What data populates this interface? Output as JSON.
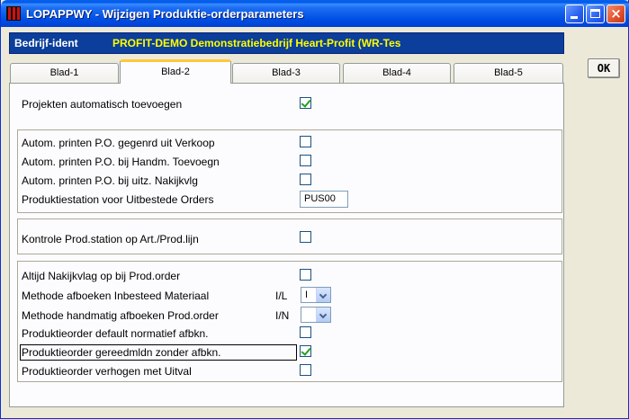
{
  "window": {
    "title": "LOPAPPWY - Wijzigen Produktie-orderparameters",
    "controls": {
      "minimize": "minimize-icon",
      "maximize": "maximize-icon",
      "close": "×"
    }
  },
  "company": {
    "label": "Bedrijf-ident",
    "name": "PROFIT-DEMO Demonstratiebedrijf Heart-Profit (WR-Tes",
    "label_color": "#ffffff",
    "name_color": "#ffff00",
    "bar_color": "#0c3e9b"
  },
  "ok_label": "OK",
  "tabs": [
    {
      "label": "Blad-1",
      "active": false
    },
    {
      "label": "Blad-2",
      "active": true
    },
    {
      "label": "Blad-3",
      "active": false
    },
    {
      "label": "Blad-4",
      "active": false
    },
    {
      "label": "Blad-5",
      "active": false
    }
  ],
  "settings": {
    "projects_auto_add": {
      "label": "Projekten automatisch toevoegen",
      "checked": true
    },
    "print_from_sales": {
      "label": "Autom. printen P.O. gegenrd uit Verkoop",
      "checked": false
    },
    "print_manual_add": {
      "label": "Autom. printen P.O. bij Handm. Toevoegn",
      "checked": false
    },
    "print_check_flag": {
      "label": "Autom. printen P.O. bij uitz. Nakijkvlg",
      "checked": false
    },
    "outsourced_station": {
      "label": "Produktiestation voor Uitbestede Orders",
      "value": "PUS00"
    },
    "check_station": {
      "label": "Kontrole Prod.station op Art./Prod.lijn",
      "checked": false
    },
    "always_check_flag": {
      "label": "Altijd Nakijkvlag op bij Prod.order",
      "checked": false
    },
    "method_insourced": {
      "label": "Methode afboeken Inbesteed Materiaal",
      "code": "I/L",
      "value": "I"
    },
    "method_manual": {
      "label": "Methode handmatig afboeken Prod.order",
      "code": "I/N",
      "value": ""
    },
    "default_normative": {
      "label": "Produktieorder default normatief afbkn.",
      "checked": false
    },
    "ready_no_booking": {
      "label": "Produktieorder gereedmldn zonder afbkn.",
      "checked": true
    },
    "raise_with_loss": {
      "label": "Produktieorder verhogen met Uitval",
      "checked": false
    }
  }
}
